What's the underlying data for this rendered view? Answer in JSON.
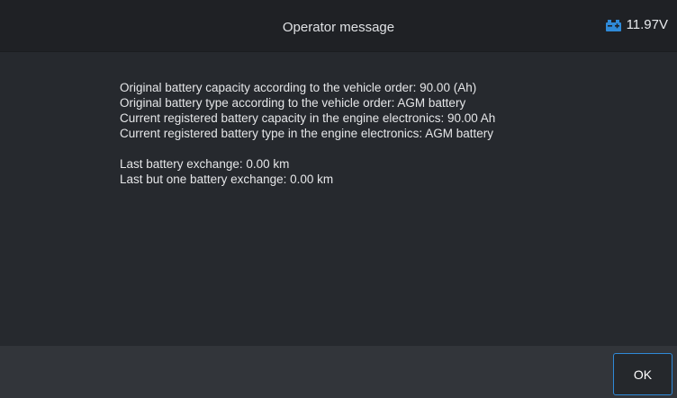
{
  "header": {
    "title": "Operator message",
    "battery_icon": "battery-icon",
    "voltage": "11.97V",
    "accent_color": "#2f8ad8"
  },
  "message": {
    "lines_group1": [
      "Original battery capacity according to the vehicle order: 90.00  (Ah)",
      "Original battery type according to the vehicle order: AGM battery",
      "Current registered battery capacity in the engine electronics: 90.00 Ah",
      "Current registered battery type in the engine electronics: AGM battery"
    ],
    "lines_group2": [
      "Last battery exchange: 0.00 km",
      "Last but one battery exchange: 0.00 km"
    ]
  },
  "footer": {
    "ok_label": "OK"
  }
}
